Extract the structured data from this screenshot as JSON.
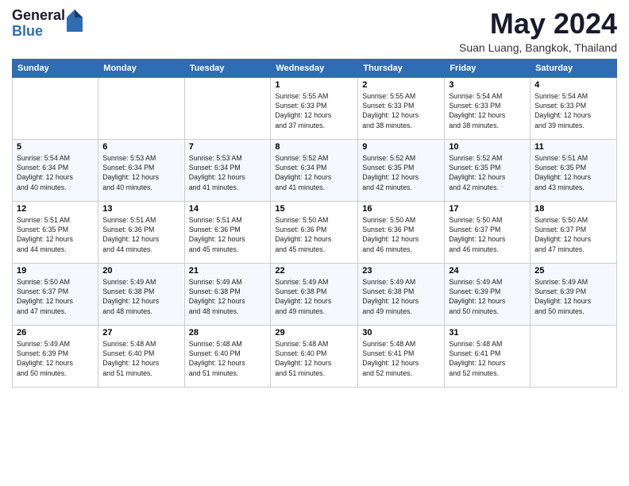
{
  "logo": {
    "general": "General",
    "blue": "Blue"
  },
  "title": "May 2024",
  "location": "Suan Luang, Bangkok, Thailand",
  "days_of_week": [
    "Sunday",
    "Monday",
    "Tuesday",
    "Wednesday",
    "Thursday",
    "Friday",
    "Saturday"
  ],
  "weeks": [
    [
      {
        "num": "",
        "info": ""
      },
      {
        "num": "",
        "info": ""
      },
      {
        "num": "",
        "info": ""
      },
      {
        "num": "1",
        "info": "Sunrise: 5:55 AM\nSunset: 6:33 PM\nDaylight: 12 hours\nand 37 minutes."
      },
      {
        "num": "2",
        "info": "Sunrise: 5:55 AM\nSunset: 6:33 PM\nDaylight: 12 hours\nand 38 minutes."
      },
      {
        "num": "3",
        "info": "Sunrise: 5:54 AM\nSunset: 6:33 PM\nDaylight: 12 hours\nand 38 minutes."
      },
      {
        "num": "4",
        "info": "Sunrise: 5:54 AM\nSunset: 6:33 PM\nDaylight: 12 hours\nand 39 minutes."
      }
    ],
    [
      {
        "num": "5",
        "info": "Sunrise: 5:54 AM\nSunset: 6:34 PM\nDaylight: 12 hours\nand 40 minutes."
      },
      {
        "num": "6",
        "info": "Sunrise: 5:53 AM\nSunset: 6:34 PM\nDaylight: 12 hours\nand 40 minutes."
      },
      {
        "num": "7",
        "info": "Sunrise: 5:53 AM\nSunset: 6:34 PM\nDaylight: 12 hours\nand 41 minutes."
      },
      {
        "num": "8",
        "info": "Sunrise: 5:52 AM\nSunset: 6:34 PM\nDaylight: 12 hours\nand 41 minutes."
      },
      {
        "num": "9",
        "info": "Sunrise: 5:52 AM\nSunset: 6:35 PM\nDaylight: 12 hours\nand 42 minutes."
      },
      {
        "num": "10",
        "info": "Sunrise: 5:52 AM\nSunset: 6:35 PM\nDaylight: 12 hours\nand 42 minutes."
      },
      {
        "num": "11",
        "info": "Sunrise: 5:51 AM\nSunset: 6:35 PM\nDaylight: 12 hours\nand 43 minutes."
      }
    ],
    [
      {
        "num": "12",
        "info": "Sunrise: 5:51 AM\nSunset: 6:35 PM\nDaylight: 12 hours\nand 44 minutes."
      },
      {
        "num": "13",
        "info": "Sunrise: 5:51 AM\nSunset: 6:36 PM\nDaylight: 12 hours\nand 44 minutes."
      },
      {
        "num": "14",
        "info": "Sunrise: 5:51 AM\nSunset: 6:36 PM\nDaylight: 12 hours\nand 45 minutes."
      },
      {
        "num": "15",
        "info": "Sunrise: 5:50 AM\nSunset: 6:36 PM\nDaylight: 12 hours\nand 45 minutes."
      },
      {
        "num": "16",
        "info": "Sunrise: 5:50 AM\nSunset: 6:36 PM\nDaylight: 12 hours\nand 46 minutes."
      },
      {
        "num": "17",
        "info": "Sunrise: 5:50 AM\nSunset: 6:37 PM\nDaylight: 12 hours\nand 46 minutes."
      },
      {
        "num": "18",
        "info": "Sunrise: 5:50 AM\nSunset: 6:37 PM\nDaylight: 12 hours\nand 47 minutes."
      }
    ],
    [
      {
        "num": "19",
        "info": "Sunrise: 5:50 AM\nSunset: 6:37 PM\nDaylight: 12 hours\nand 47 minutes."
      },
      {
        "num": "20",
        "info": "Sunrise: 5:49 AM\nSunset: 6:38 PM\nDaylight: 12 hours\nand 48 minutes."
      },
      {
        "num": "21",
        "info": "Sunrise: 5:49 AM\nSunset: 6:38 PM\nDaylight: 12 hours\nand 48 minutes."
      },
      {
        "num": "22",
        "info": "Sunrise: 5:49 AM\nSunset: 6:38 PM\nDaylight: 12 hours\nand 49 minutes."
      },
      {
        "num": "23",
        "info": "Sunrise: 5:49 AM\nSunset: 6:38 PM\nDaylight: 12 hours\nand 49 minutes."
      },
      {
        "num": "24",
        "info": "Sunrise: 5:49 AM\nSunset: 6:39 PM\nDaylight: 12 hours\nand 50 minutes."
      },
      {
        "num": "25",
        "info": "Sunrise: 5:49 AM\nSunset: 6:39 PM\nDaylight: 12 hours\nand 50 minutes."
      }
    ],
    [
      {
        "num": "26",
        "info": "Sunrise: 5:49 AM\nSunset: 6:39 PM\nDaylight: 12 hours\nand 50 minutes."
      },
      {
        "num": "27",
        "info": "Sunrise: 5:48 AM\nSunset: 6:40 PM\nDaylight: 12 hours\nand 51 minutes."
      },
      {
        "num": "28",
        "info": "Sunrise: 5:48 AM\nSunset: 6:40 PM\nDaylight: 12 hours\nand 51 minutes."
      },
      {
        "num": "29",
        "info": "Sunrise: 5:48 AM\nSunset: 6:40 PM\nDaylight: 12 hours\nand 51 minutes."
      },
      {
        "num": "30",
        "info": "Sunrise: 5:48 AM\nSunset: 6:41 PM\nDaylight: 12 hours\nand 52 minutes."
      },
      {
        "num": "31",
        "info": "Sunrise: 5:48 AM\nSunset: 6:41 PM\nDaylight: 12 hours\nand 52 minutes."
      },
      {
        "num": "",
        "info": ""
      }
    ]
  ]
}
